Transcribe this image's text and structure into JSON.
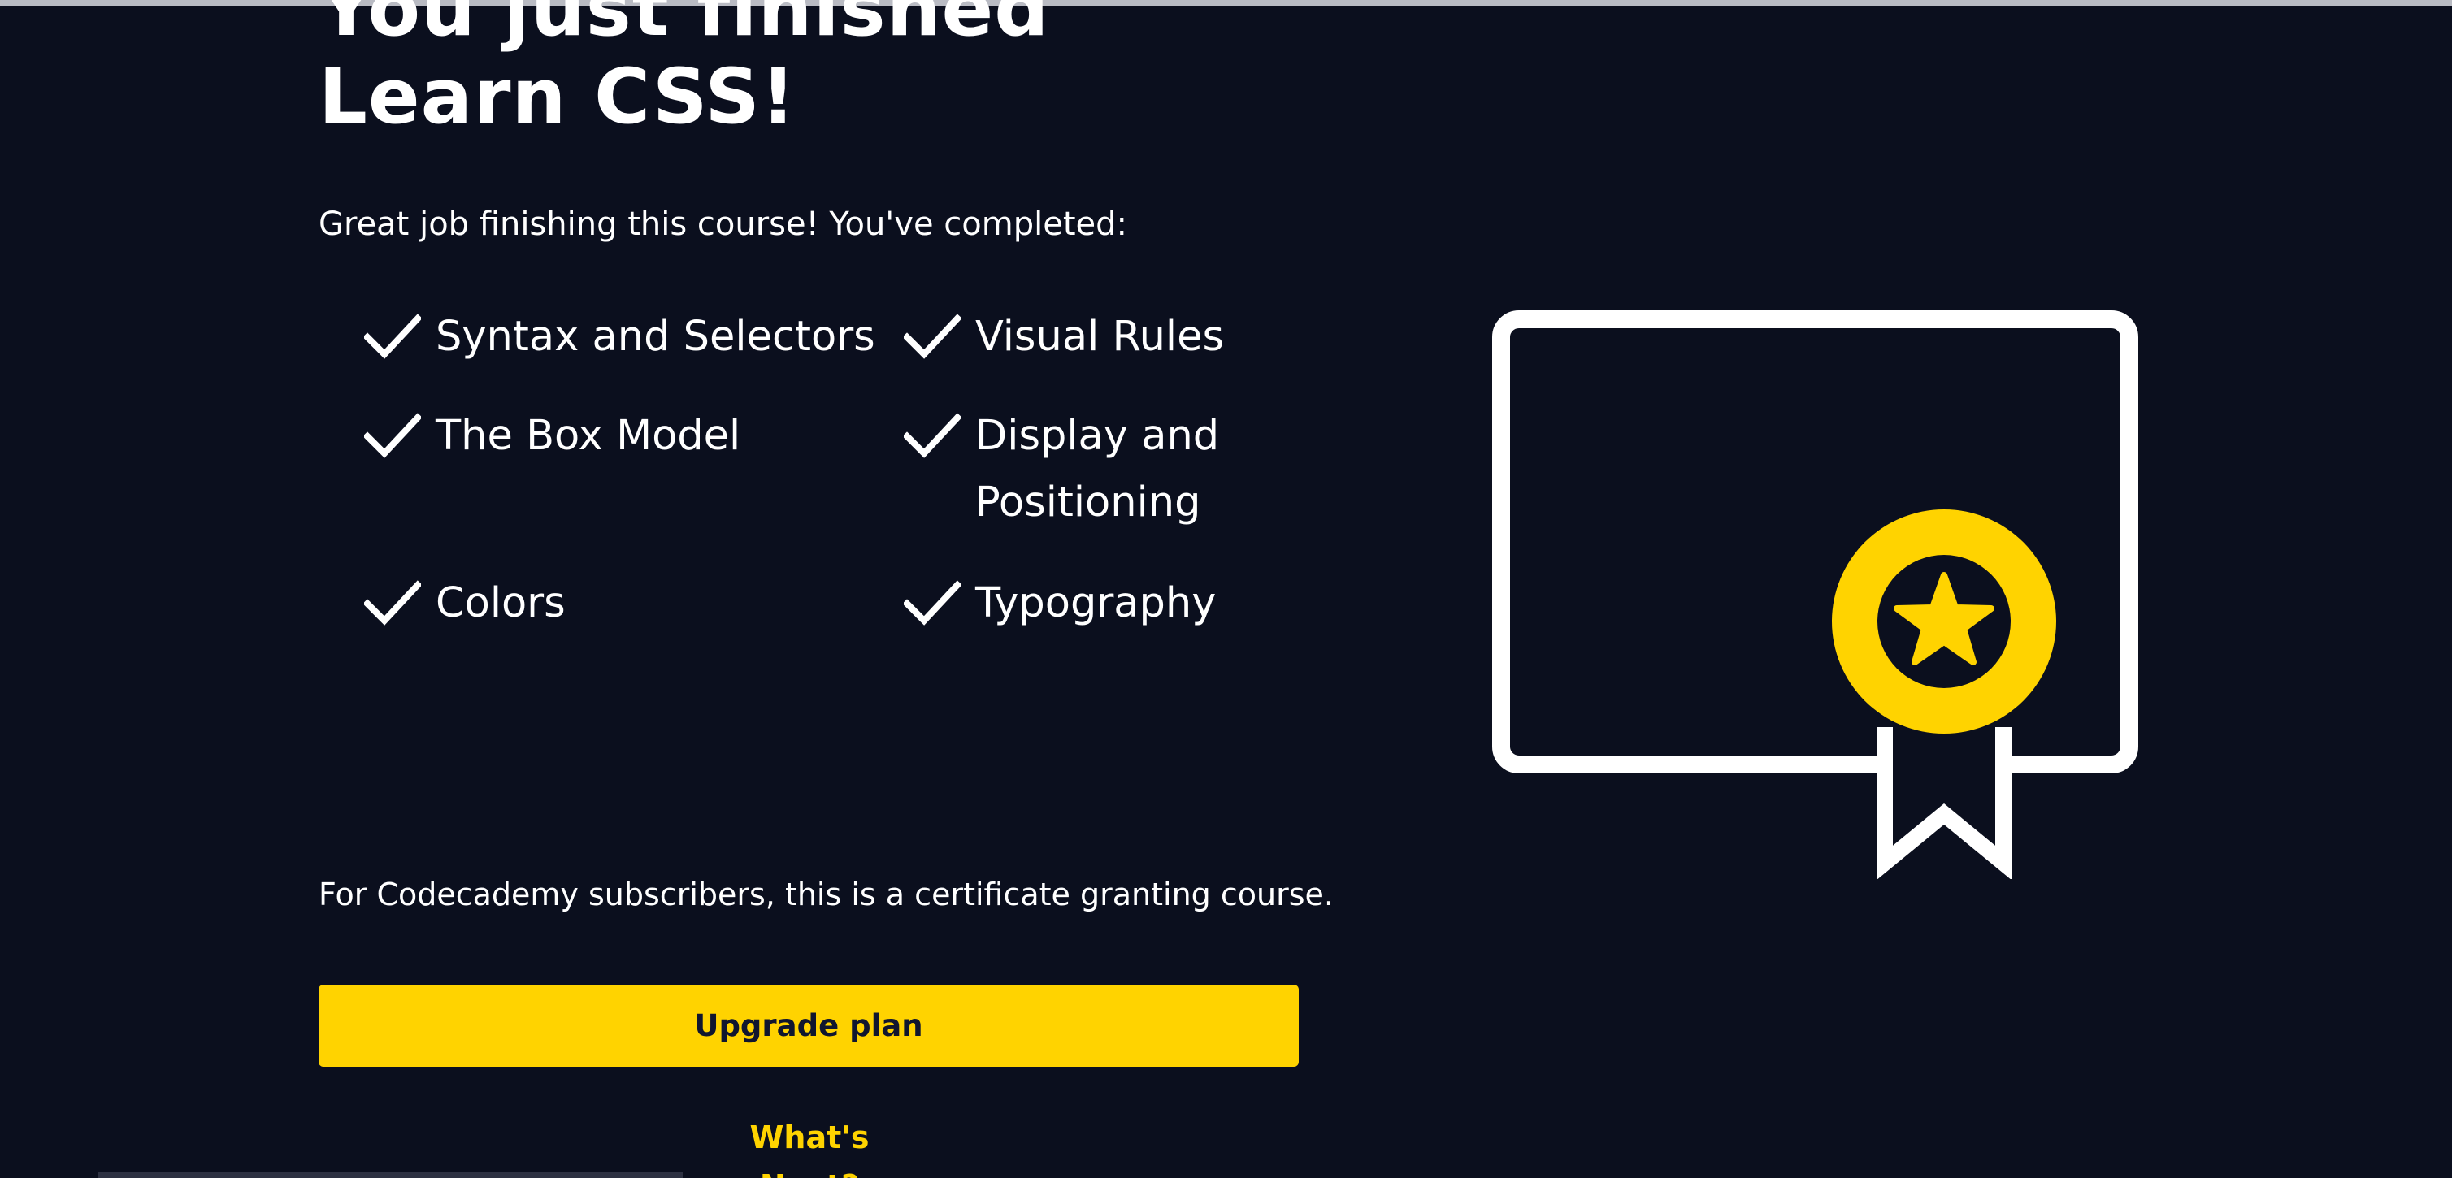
{
  "completion": {
    "title_line_1": "You just finished",
    "title_line_2": "Learn CSS!",
    "intro": "Great job finishing this course! You've completed:"
  },
  "topics": [
    {
      "label": "Syntax and Selectors"
    },
    {
      "label": "Visual Rules"
    },
    {
      "label": "The Box Model"
    },
    {
      "label": "Display and Positioning"
    },
    {
      "label": "Colors"
    },
    {
      "label": "Typography"
    }
  ],
  "subscriber_note": "For Codecademy subscribers, this is a certificate granting course.",
  "actions": {
    "upgrade_label": "Upgrade plan",
    "whats_next_label": "What's Next?"
  },
  "icons": {
    "check": "check-icon",
    "certificate": "certificate-icon",
    "award": "award-ribbon-icon",
    "star": "star-icon"
  },
  "colors": {
    "background": "#0b0f1e",
    "text": "#ffffff",
    "accent": "#ffd300",
    "button_text": "#10162f"
  }
}
